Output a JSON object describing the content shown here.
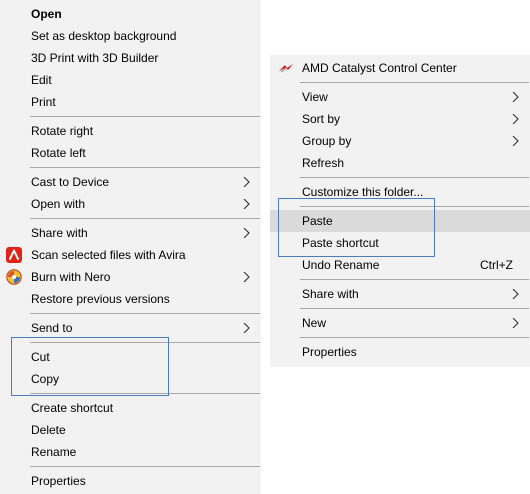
{
  "left_menu": {
    "items": [
      {
        "label": "Open"
      },
      {
        "label": "Set as desktop background"
      },
      {
        "label": "3D Print with 3D Builder"
      },
      {
        "label": "Edit"
      },
      {
        "label": "Print"
      },
      {
        "label": "Rotate right"
      },
      {
        "label": "Rotate left"
      },
      {
        "label": "Cast to Device"
      },
      {
        "label": "Open with"
      },
      {
        "label": "Share with"
      },
      {
        "label": "Scan selected files with Avira",
        "icon": "avira-umbrella-icon"
      },
      {
        "label": "Burn with Nero",
        "icon": "nero-disc-icon"
      },
      {
        "label": "Restore previous versions"
      },
      {
        "label": "Send to"
      },
      {
        "label": "Cut"
      },
      {
        "label": "Copy"
      },
      {
        "label": "Create shortcut"
      },
      {
        "label": "Delete"
      },
      {
        "label": "Rename"
      },
      {
        "label": "Properties"
      }
    ]
  },
  "right_menu": {
    "items": [
      {
        "label": "AMD Catalyst Control Center",
        "icon": "amd-catalyst-icon"
      },
      {
        "label": "View"
      },
      {
        "label": "Sort by"
      },
      {
        "label": "Group by"
      },
      {
        "label": "Refresh"
      },
      {
        "label": "Customize this folder..."
      },
      {
        "label": "Paste"
      },
      {
        "label": "Paste shortcut"
      },
      {
        "label": "Undo Rename",
        "shortcut": "Ctrl+Z"
      },
      {
        "label": "Share with"
      },
      {
        "label": "New"
      },
      {
        "label": "Properties"
      }
    ]
  },
  "colors": {
    "menu_background": "#f2f2f2",
    "separator": "#a9a9a9",
    "hover_highlight": "#dadada",
    "annotation_box": "#4a7cc4",
    "avira_red": "#e2231a",
    "amd_red": "#d31f26"
  }
}
